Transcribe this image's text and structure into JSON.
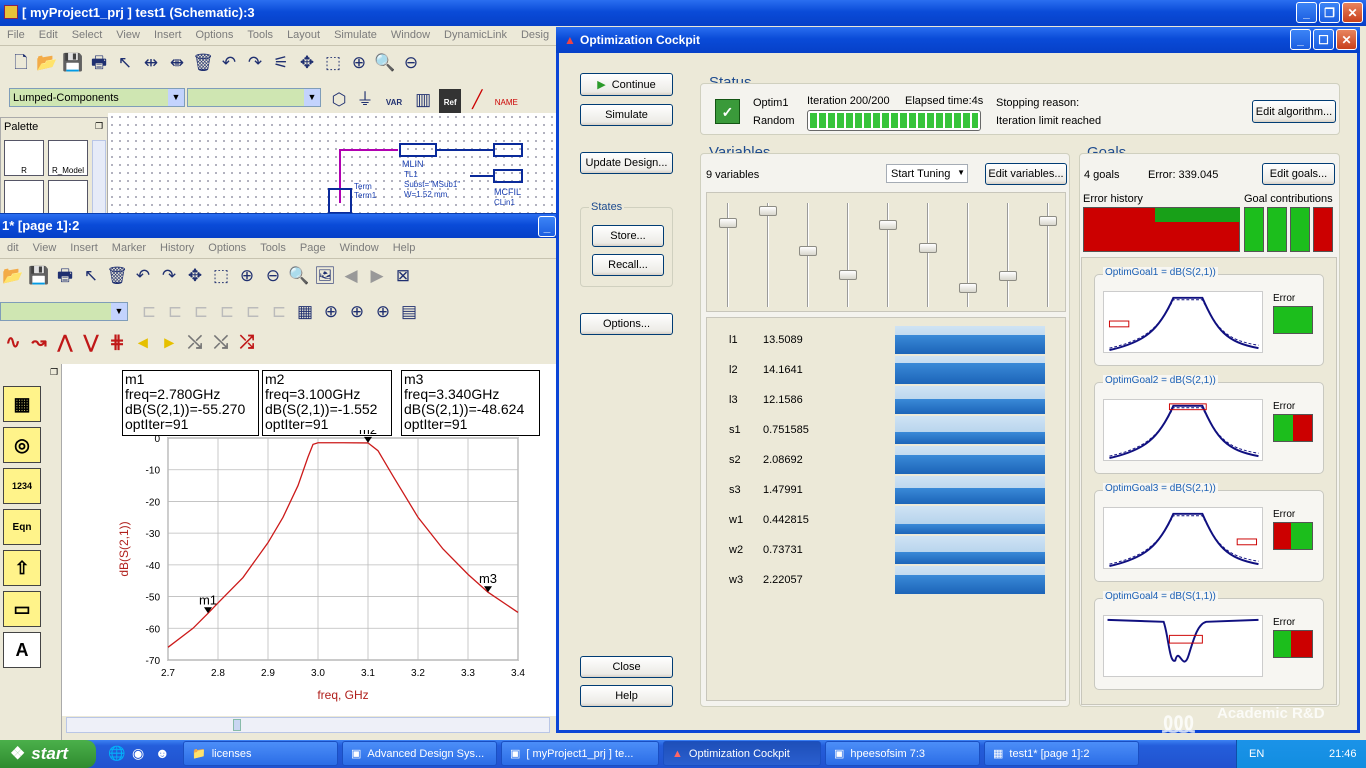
{
  "schematic": {
    "title": "[ myProject1_prj ] test1 (Schematic):3",
    "menu": [
      "File",
      "Edit",
      "Select",
      "View",
      "Insert",
      "Options",
      "Tools",
      "Layout",
      "Simulate",
      "Window",
      "DynamicLink",
      "Desig"
    ],
    "component_library": "Lumped-Components",
    "palette_title": "Palette",
    "palette_items": [
      "R",
      "R_Model"
    ],
    "toolbar_labels": {
      "var": "VAR",
      "name": "NAME",
      "ref": "Ref"
    },
    "components": {
      "mlin": "MLIN",
      "mlin_lines": [
        "TL1",
        "Subst=\"MSub1\"",
        "W=1.52 mm"
      ],
      "term": "Term",
      "term_id": "Term1",
      "mcfil": "MCFIL",
      "mcfil_id": "CLin1"
    }
  },
  "datadisplay": {
    "title": "1* [page 1]:2",
    "menu": [
      "dit",
      "View",
      "Insert",
      "Marker",
      "History",
      "Options",
      "Tools",
      "Page",
      "Window",
      "Help"
    ],
    "markers": [
      {
        "text": "m1\nfreq=2.780GHz\ndB(S(2,1))=-55.270\noptIter=91"
      },
      {
        "text": "m2\nfreq=3.100GHz\ndB(S(2,1))=-1.552\noptIter=91"
      },
      {
        "text": "m3\nfreq=3.340GHz\ndB(S(2,1))=-48.624\noptIter=91"
      }
    ],
    "marker_labels": [
      "m1",
      "m2",
      "m3"
    ]
  },
  "chart_data": {
    "type": "line",
    "xlabel": "freq, GHz",
    "ylabel": "dB(S(2,1))",
    "xlim": [
      2.7,
      3.4
    ],
    "ylim": [
      -70,
      0
    ],
    "xticks": [
      2.7,
      2.8,
      2.9,
      3.0,
      3.1,
      3.2,
      3.3,
      3.4
    ],
    "yticks": [
      0,
      -10,
      -20,
      -30,
      -40,
      -50,
      -60,
      -70
    ],
    "series": [
      {
        "color": "#cc1a1a",
        "x": [
          2.7,
          2.75,
          2.78,
          2.8,
          2.85,
          2.9,
          2.93,
          2.96,
          2.98,
          2.99,
          3.0,
          3.05,
          3.1,
          3.12,
          3.15,
          3.2,
          3.25,
          3.3,
          3.34,
          3.4
        ],
        "y": [
          -66,
          -60,
          -55.27,
          -52,
          -44,
          -33,
          -25,
          -15,
          -6,
          -2,
          -1.5,
          -1.5,
          -1.55,
          -4,
          -12,
          -25,
          -35,
          -43,
          -48.62,
          -55
        ]
      }
    ],
    "markers": [
      {
        "name": "m1",
        "x": 2.78,
        "y": -55.27
      },
      {
        "name": "m2",
        "x": 3.1,
        "y": -1.552
      },
      {
        "name": "m3",
        "x": 3.34,
        "y": -48.624
      }
    ]
  },
  "cockpit": {
    "title": "Optimization Cockpit",
    "buttons": {
      "continue": "Continue",
      "simulate": "Simulate",
      "update_design": "Update Design...",
      "store": "Store...",
      "recall": "Recall...",
      "options": "Options...",
      "close": "Close",
      "help": "Help",
      "edit_algorithm": "Edit algorithm...",
      "edit_variables": "Edit variables...",
      "edit_goals": "Edit goals...",
      "start_tuning": "Start Tuning"
    },
    "states_label": "States",
    "status": {
      "heading": "Status",
      "optimizer": "Optim1",
      "type": "Random",
      "iteration": "Iteration 200/200",
      "elapsed": "Elapsed time:4s",
      "stopping_label": "Stopping reason:",
      "stopping_reason": "Iteration limit reached",
      "progress": 1.0
    },
    "variables": {
      "heading": "Variables",
      "count": "9 variables",
      "slider_levels": [
        0.8,
        0.92,
        0.52,
        0.28,
        0.78,
        0.55,
        0.15,
        0.27,
        0.82
      ],
      "items": [
        {
          "name": "l1",
          "value": "13.5089"
        },
        {
          "name": "l2",
          "value": "14.1641"
        },
        {
          "name": "l3",
          "value": "12.1586"
        },
        {
          "name": "s1",
          "value": "0.751585"
        },
        {
          "name": "s2",
          "value": "2.08692"
        },
        {
          "name": "s3",
          "value": "1.47991"
        },
        {
          "name": "w1",
          "value": "0.442815"
        },
        {
          "name": "w2",
          "value": "0.73731"
        },
        {
          "name": "w3",
          "value": "2.22057"
        }
      ]
    },
    "goals": {
      "heading": "Goals",
      "count": "4 goals",
      "error": "Error: 339.045",
      "error_history_label": "Error history",
      "goal_contributions_label": "Goal contributions",
      "error_label": "Error",
      "items": [
        {
          "title": "OptimGoal1 = dB(S(2,1))"
        },
        {
          "title": "OptimGoal2 = dB(S(2,1))"
        },
        {
          "title": "OptimGoal3 = dB(S(2,1))"
        },
        {
          "title": "OptimGoal4 = dB(S(1,1))"
        }
      ]
    }
  },
  "taskbar": {
    "start": "start",
    "items": [
      "licenses",
      "Advanced Design Sys...",
      "[ myProject1_prj ] te...",
      "Optimization Cockpit",
      "hpeesofsim 7:3",
      "test1* [page 1]:2"
    ],
    "lang": "EN",
    "clock": "21:46",
    "watermark": "Academic R&D"
  }
}
